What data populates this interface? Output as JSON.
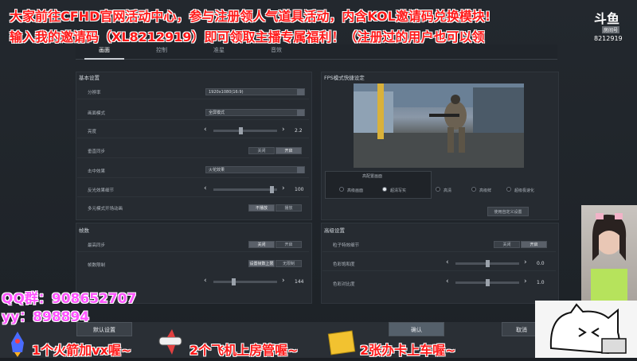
{
  "stream_overlay": {
    "line1": "大家前往CFHD官网活动中心，参与注册领人气道具活动，内含KOL邀请码兑换模块!",
    "line2": "输入我的邀请码（XL8212919）即可领取主播专属福利！（注册过的用户也可以领",
    "logo_text": "斗鱼",
    "room_badge": "房间号",
    "room_number": "8212919",
    "qq_group": "QQ群：908652707",
    "yy": "yy：898894",
    "promo1": "1个火箭加vx喔~",
    "promo2": "2个飞机上房管喔~",
    "promo3": "2张办卡上车喔~"
  },
  "tabs": [
    {
      "label": "画面"
    },
    {
      "label": "控制"
    },
    {
      "label": "准星"
    },
    {
      "label": "音效"
    }
  ],
  "basic": {
    "title": "基本设置",
    "rows": {
      "resolution": {
        "label": "分辨率",
        "value": "1920x1080(16:9)"
      },
      "display_mode": {
        "label": "画面模式",
        "value": "全屏模式"
      },
      "brightness": {
        "label": "亮度",
        "value": "2.2",
        "level": 0.42
      },
      "vsync": {
        "label": "垂直同步",
        "off": "关闭",
        "on": "开启"
      },
      "hit_effect": {
        "label": "击中效果",
        "value": "火花效果"
      },
      "aa": {
        "label": "反光效果细节",
        "value": "100",
        "level": 0.95
      },
      "anim": {
        "label": "多元模式开场动画",
        "opt1": "不播放",
        "opt2": "播放"
      }
    }
  },
  "frame": {
    "title": "帧数",
    "rows": {
      "max_fps": {
        "label": "最高同步",
        "off": "关闭",
        "on": "开启"
      },
      "fps_limit": {
        "label": "帧数限制",
        "opt1": "设置帧数上限",
        "opt2": "无限制"
      },
      "fps_value": {
        "value": "144",
        "level": 0.3
      }
    }
  },
  "fps_panel": {
    "title": "FPS模式快捷设定",
    "quality_title": "高配置画面",
    "options": [
      "高级画面",
      "超清写实",
      "高清",
      "高级鲜",
      "超级极速化"
    ],
    "selected_index": 1,
    "custom_button": "使用自定义设置"
  },
  "advanced": {
    "title": "高级设置",
    "rows": {
      "particles": {
        "label": "粒子特效细节",
        "off": "关闭",
        "on": "开启"
      },
      "saturation": {
        "label": "色彩饱和度",
        "value": "0.0",
        "level": 0.5
      },
      "contrast": {
        "label": "色彩对比度",
        "value": "1.0",
        "level": 0.5
      }
    }
  },
  "footer": {
    "default_button": "默认设置",
    "confirm_button": "确认",
    "cancel_button": "取消"
  },
  "colors": {
    "overlay_red": "#ff1a1a",
    "overlay_pink": "#ff55ff",
    "accent": "#e6e9ec"
  }
}
